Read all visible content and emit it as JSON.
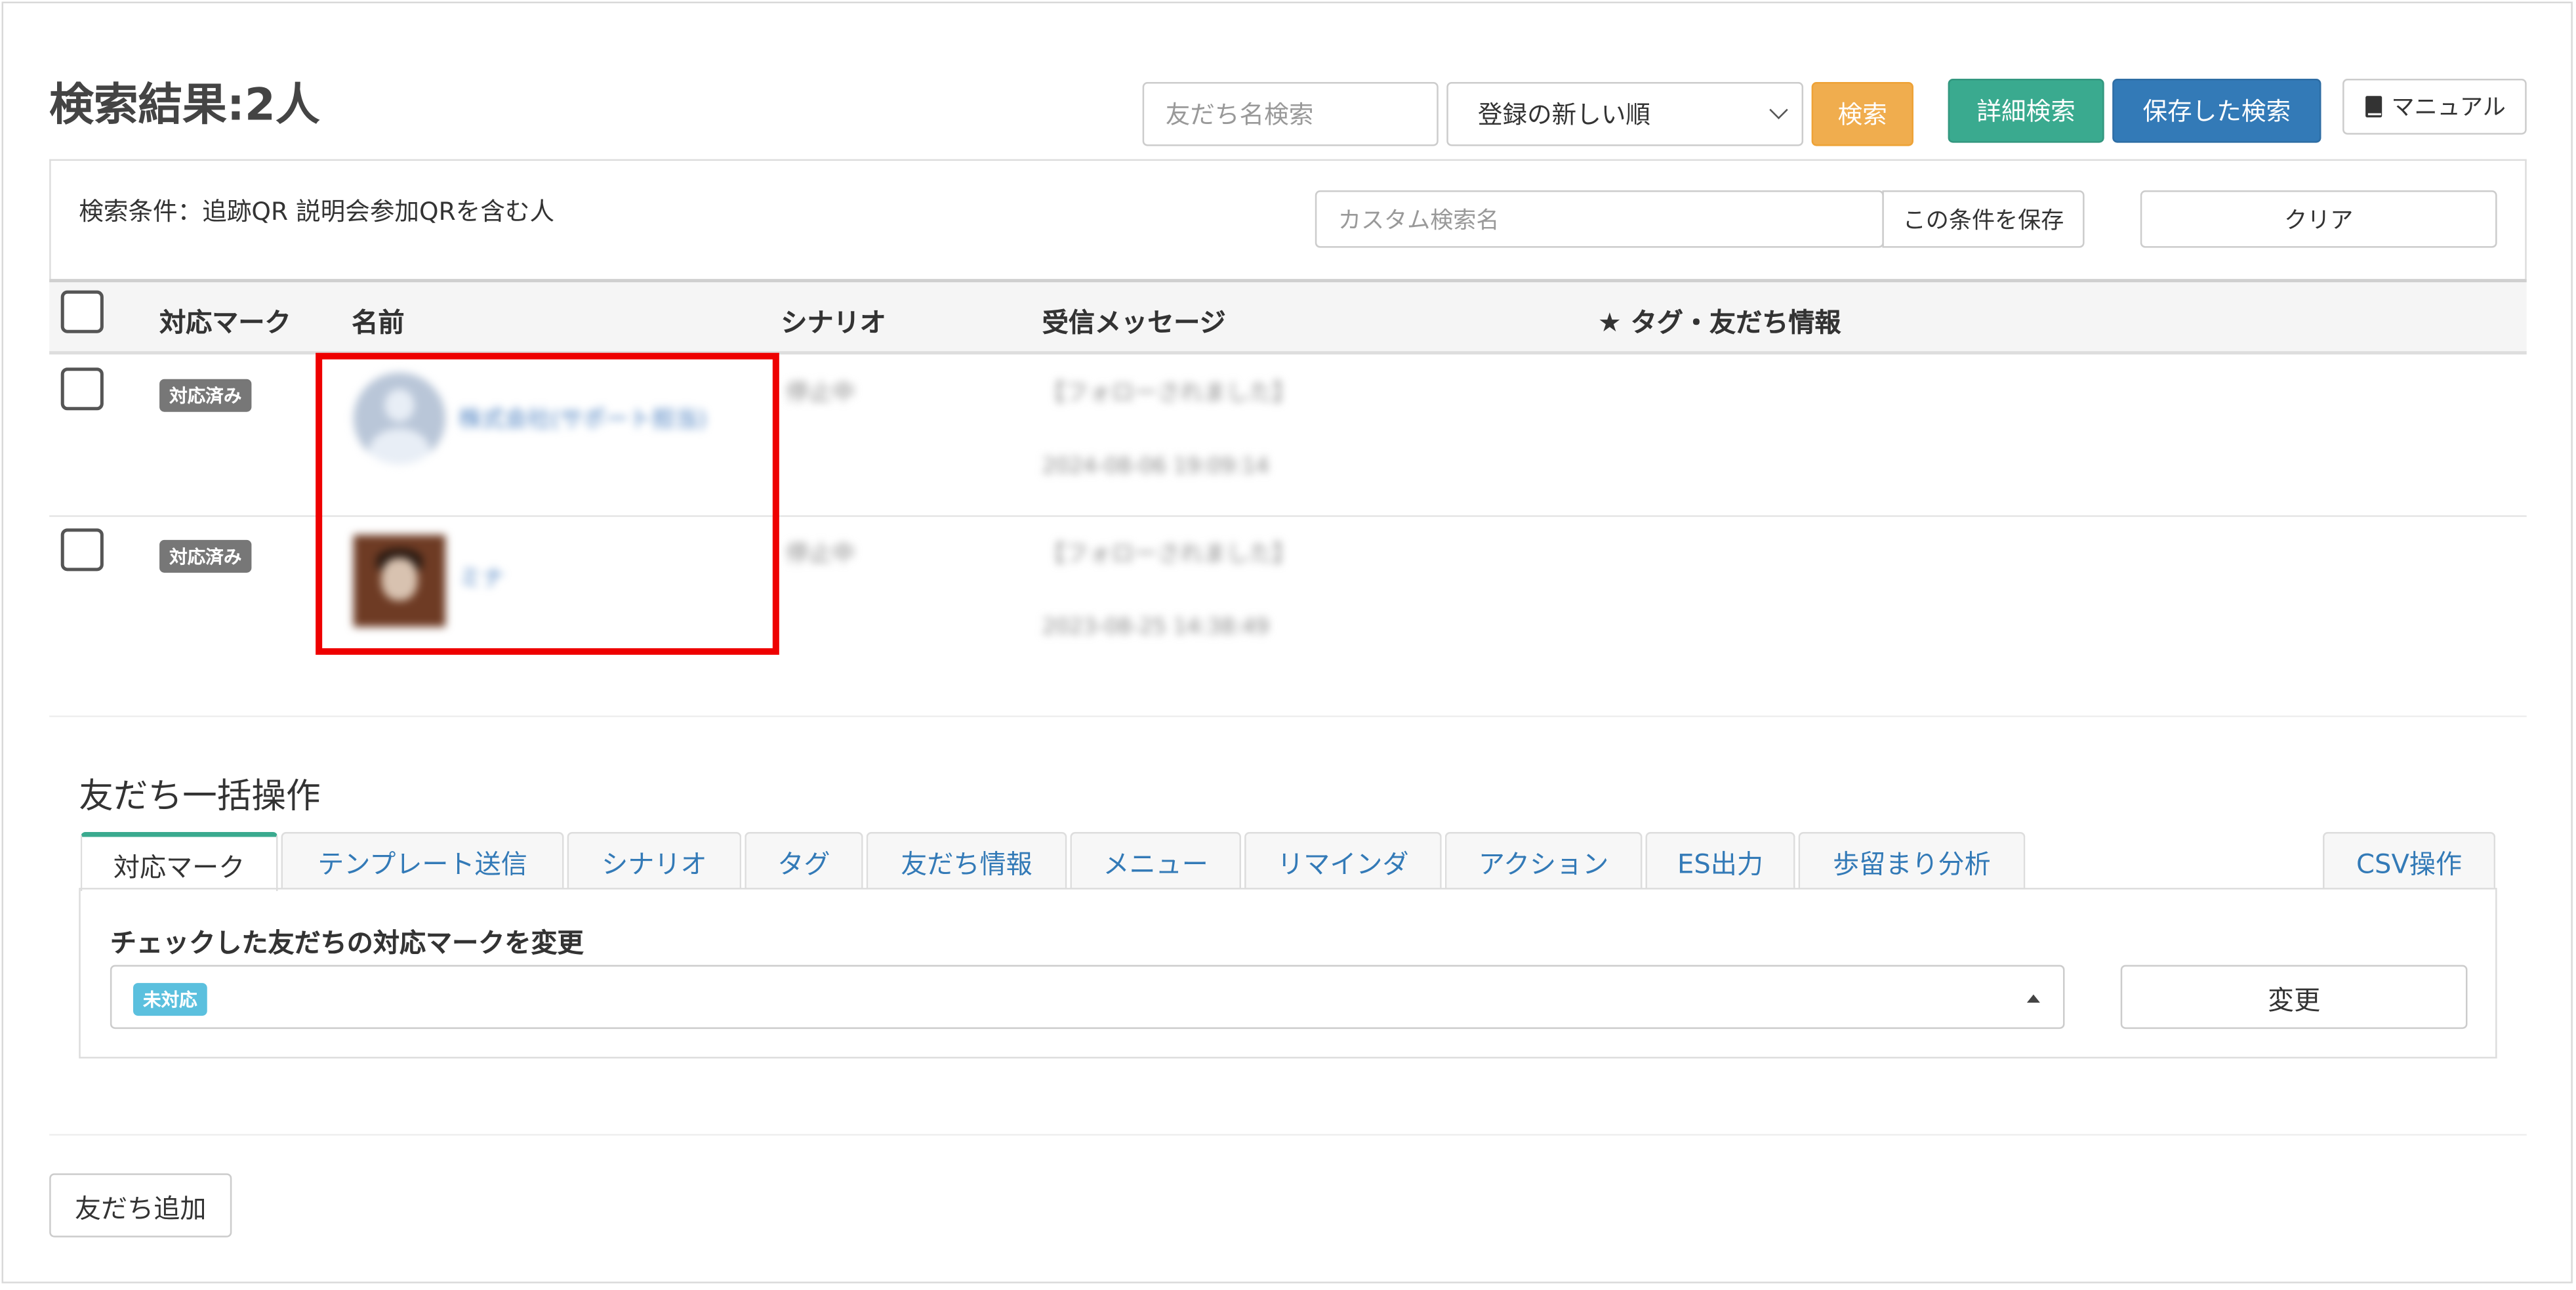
{
  "header": {
    "title": "検索結果:2人",
    "name_search_placeholder": "友だち名検索",
    "sort_selected": "登録の新しい順",
    "search_button": "検索",
    "detail_search_button": "詳細検索",
    "saved_search_button": "保存した検索",
    "manual_button": "マニュアル"
  },
  "condition": {
    "text": "検索条件：追跡QR 説明会参加QRを含む人",
    "custom_name_placeholder": "カスタム検索名",
    "save_condition_button": "この条件を保存",
    "clear_button": "クリア"
  },
  "table": {
    "columns": [
      "対応マーク",
      "名前",
      "シナリオ",
      "受信メッセージ",
      "★ タグ・友だち情報"
    ],
    "rows": [
      {
        "mark": "対応済み",
        "name": "株式会社(サポート担当)",
        "scenario": "停止中",
        "message": "【フォローされました】",
        "datetime": "2024-08-06 19:09:14"
      },
      {
        "mark": "対応済み",
        "name": "ミナ",
        "scenario": "停止中",
        "message": "【フォローされました】",
        "datetime": "2023-08-25 14:38:49"
      }
    ]
  },
  "bulk": {
    "title": "友だち一括操作",
    "tabs": [
      "対応マーク",
      "テンプレート送信",
      "シナリオ",
      "タグ",
      "友だち情報",
      "メニュー",
      "リマインダ",
      "アクション",
      "ES出力",
      "歩留まり分析"
    ],
    "csv_tab": "CSV操作",
    "panel_label": "チェックした友だちの対応マークを変更",
    "selected_mark": "未対応",
    "change_button": "変更"
  },
  "footer": {
    "add_friend_button": "友だち追加"
  },
  "colors": {
    "orange": "#f0ad4e",
    "teal": "#3aaa8f",
    "blue": "#337ab7",
    "badge_gray": "#777777",
    "badge_cyan": "#5bc0de",
    "highlight_red": "#ee0000"
  },
  "icons": {
    "manual": "book-icon",
    "sort_dropdown": "chevron-down-icon",
    "mark_dropdown": "caret-up-icon"
  }
}
